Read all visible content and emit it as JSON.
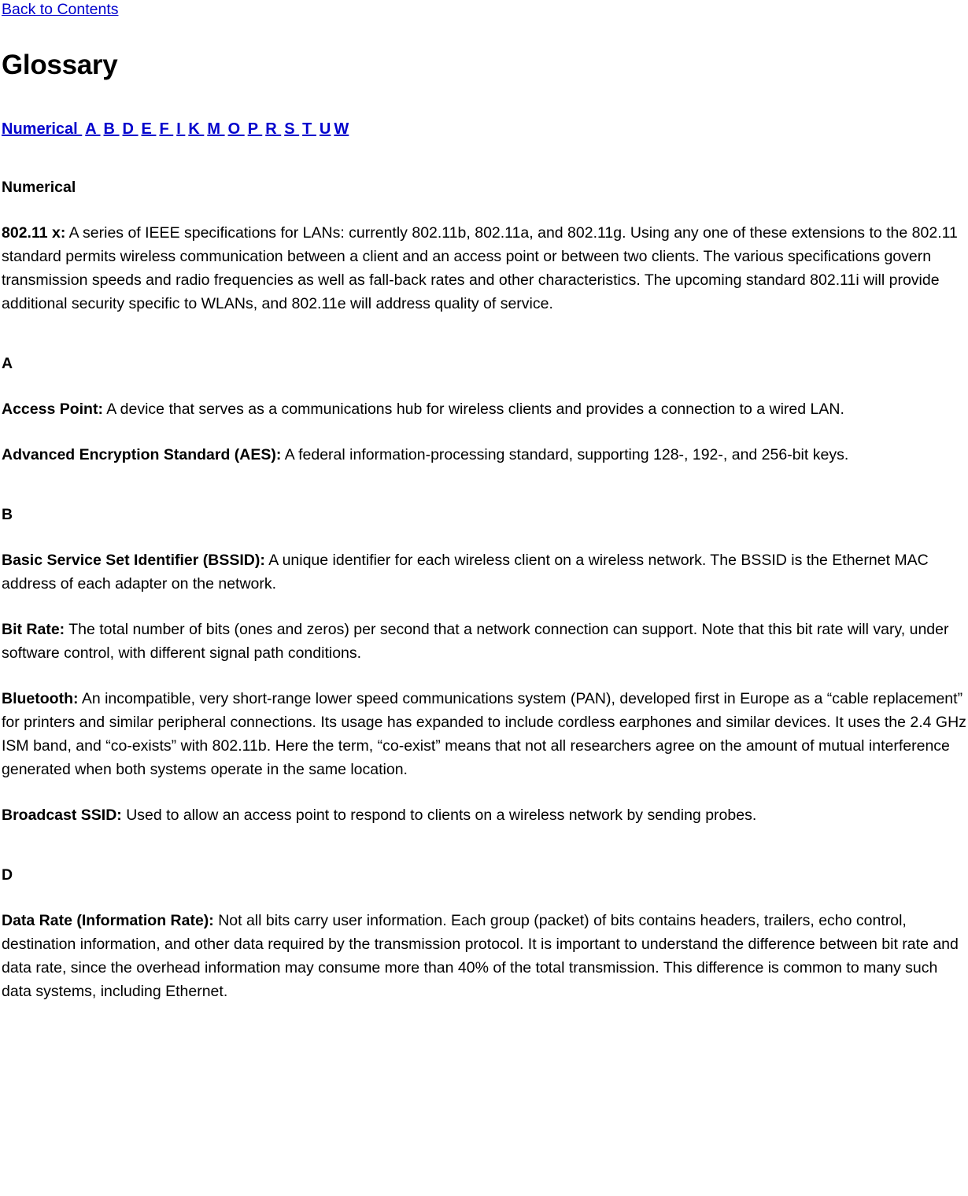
{
  "document": {
    "back_link": "Back to Contents",
    "title": "Glossary",
    "link_color": "#0000cc",
    "text_color": "#000000",
    "background_color": "#ffffff"
  },
  "alpha_nav": {
    "items": [
      {
        "label": " Numerical "
      },
      {
        "label": "A "
      },
      {
        "label": "B "
      },
      {
        "label": "D "
      },
      {
        "label": "E "
      },
      {
        "label": "F "
      },
      {
        "label": "I "
      },
      {
        "label": "K "
      },
      {
        "label": "M "
      },
      {
        "label": "O "
      },
      {
        "label": "P "
      },
      {
        "label": "R "
      },
      {
        "label": "S "
      },
      {
        "label": "T "
      },
      {
        "label": "U"
      },
      {
        "label": "W"
      }
    ]
  },
  "sections": [
    {
      "heading": "Numerical",
      "entries": [
        {
          "term": "802.11 x:",
          "definition": " A series of IEEE specifications for LANs: currently 802.11b, 802.11a, and 802.11g. Using any one of these extensions to the 802.11 standard permits wireless communication between a client and an access point or between two clients. The various specifications govern transmission speeds and radio frequencies as well as fall-back rates and other characteristics. The upcoming standard 802.11i will provide additional security specific to WLANs, and 802.11e will address quality of service."
        }
      ]
    },
    {
      "heading": "A",
      "entries": [
        {
          "term": "Access Point:",
          "definition": " A device that serves as a communications hub for wireless clients and provides a connection to a wired LAN."
        },
        {
          "term": "Advanced Encryption Standard (AES):",
          "definition": " A federal information-processing standard, supporting 128-, 192-, and 256-bit keys."
        }
      ]
    },
    {
      "heading": "B",
      "entries": [
        {
          "term": "Basic Service Set Identifier (BSSID):",
          "definition": " A unique identifier for each wireless client on a wireless network. The BSSID is the Ethernet MAC address of each adapter on the network."
        },
        {
          "term": "Bit Rate:",
          "definition": " The total number of bits (ones and zeros) per second that a network connection can support. Note that this bit rate will vary, under software control, with different signal path conditions."
        },
        {
          "term": "Bluetooth:",
          "definition": " An incompatible, very short-range lower speed communications system (PAN), developed first in Europe as a “cable replacement” for printers and similar peripheral connections. Its usage has expanded to include cordless earphones and similar devices. It uses the 2.4 GHz ISM band, and “co-exists” with 802.11b. Here the term, “co-exist” means that not all researchers agree on the amount of mutual interference generated when both systems operate in the same location."
        },
        {
          "term": "Broadcast SSID:",
          "definition": " Used to allow an access point to respond to clients on a wireless network by sending probes."
        }
      ]
    },
    {
      "heading": "D",
      "entries": [
        {
          "term": "Data Rate (Information Rate):",
          "definition": " Not all bits carry user information. Each group (packet) of bits contains headers, trailers, echo control, destination information, and other data required by the transmission protocol. It is important to understand the difference between bit rate and data rate, since the overhead information may consume more than 40% of the total transmission. This difference is common to many such data systems, including Ethernet."
        }
      ]
    }
  ]
}
